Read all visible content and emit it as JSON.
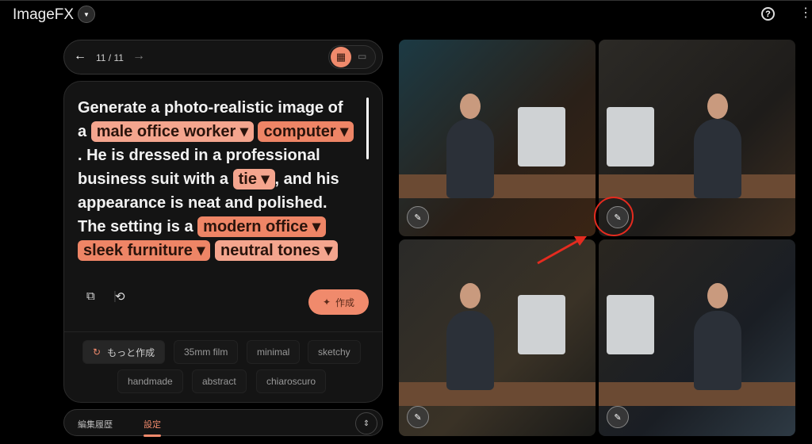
{
  "app": {
    "title": "ImageFX",
    "help_icon": "help-circle-icon",
    "more_icon": "more-vert-icon"
  },
  "toolbar": {
    "counter": "11 / 11",
    "view_modes": [
      "grid-view-icon",
      "single-view-icon"
    ],
    "selected_view": "grid"
  },
  "prompt": {
    "segments": [
      {
        "t": "Generate a photo-realistic image of a "
      },
      {
        "chip": "male office worker"
      },
      {
        "t": " "
      },
      {
        "chip": "computer",
        "dark": true
      },
      {
        "t": ". He is dressed in a professional business suit with a "
      },
      {
        "chip": "tie"
      },
      {
        "t": ", and his appearance is neat and polished. The setting is a "
      },
      {
        "chip": "modern office",
        "dark": true
      },
      {
        "t": " "
      },
      {
        "chip": "sleek furniture",
        "dark": true
      },
      {
        "t": " "
      },
      {
        "chip": "neutral tones"
      }
    ]
  },
  "actions": {
    "generate_label": "作成"
  },
  "suggestions": {
    "more_label": "もっと作成",
    "tags": [
      "35mm film",
      "minimal",
      "sketchy",
      "handmade",
      "abstract",
      "chiaroscuro"
    ]
  },
  "bottom": {
    "tabs": [
      "編集履歴",
      "設定"
    ],
    "active_tab": "設定"
  },
  "colors": {
    "accent": "#f08a6c",
    "chip": "#f4a58e",
    "annotation": "#e52b1f"
  },
  "images": {
    "count": 4,
    "highlighted_edit_index": 1
  }
}
